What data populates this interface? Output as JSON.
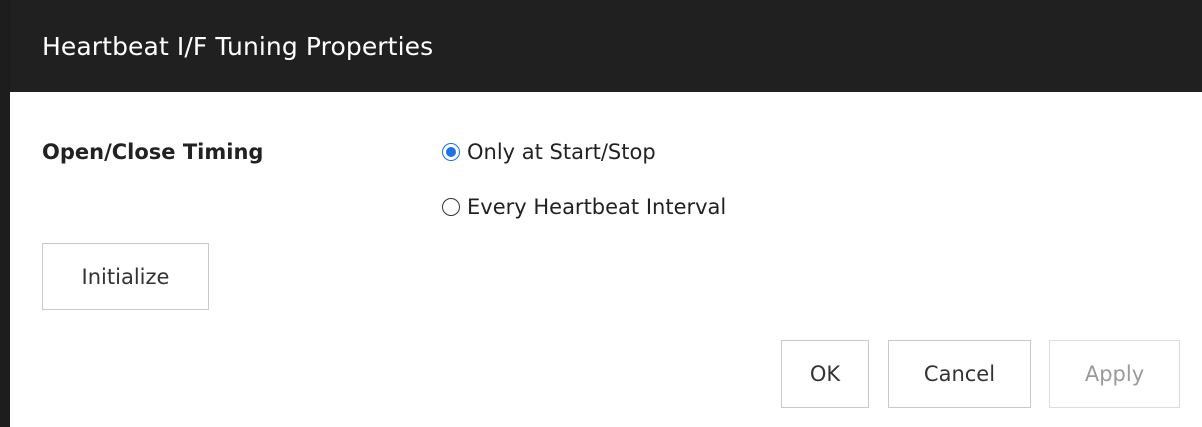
{
  "dialog": {
    "title": "Heartbeat I/F Tuning Properties"
  },
  "open_close_timing": {
    "label": "Open/Close Timing",
    "selected": "Only at Start/Stop",
    "options": [
      {
        "label": "Only at Start/Stop",
        "checked": true
      },
      {
        "label": "Every Heartbeat Interval",
        "checked": false
      }
    ]
  },
  "buttons": {
    "initialize": "Initialize",
    "ok": "OK",
    "cancel": "Cancel",
    "apply": "Apply",
    "apply_enabled": false
  },
  "colors": {
    "title_bar": "#202020",
    "accent": "#1a73e8"
  }
}
